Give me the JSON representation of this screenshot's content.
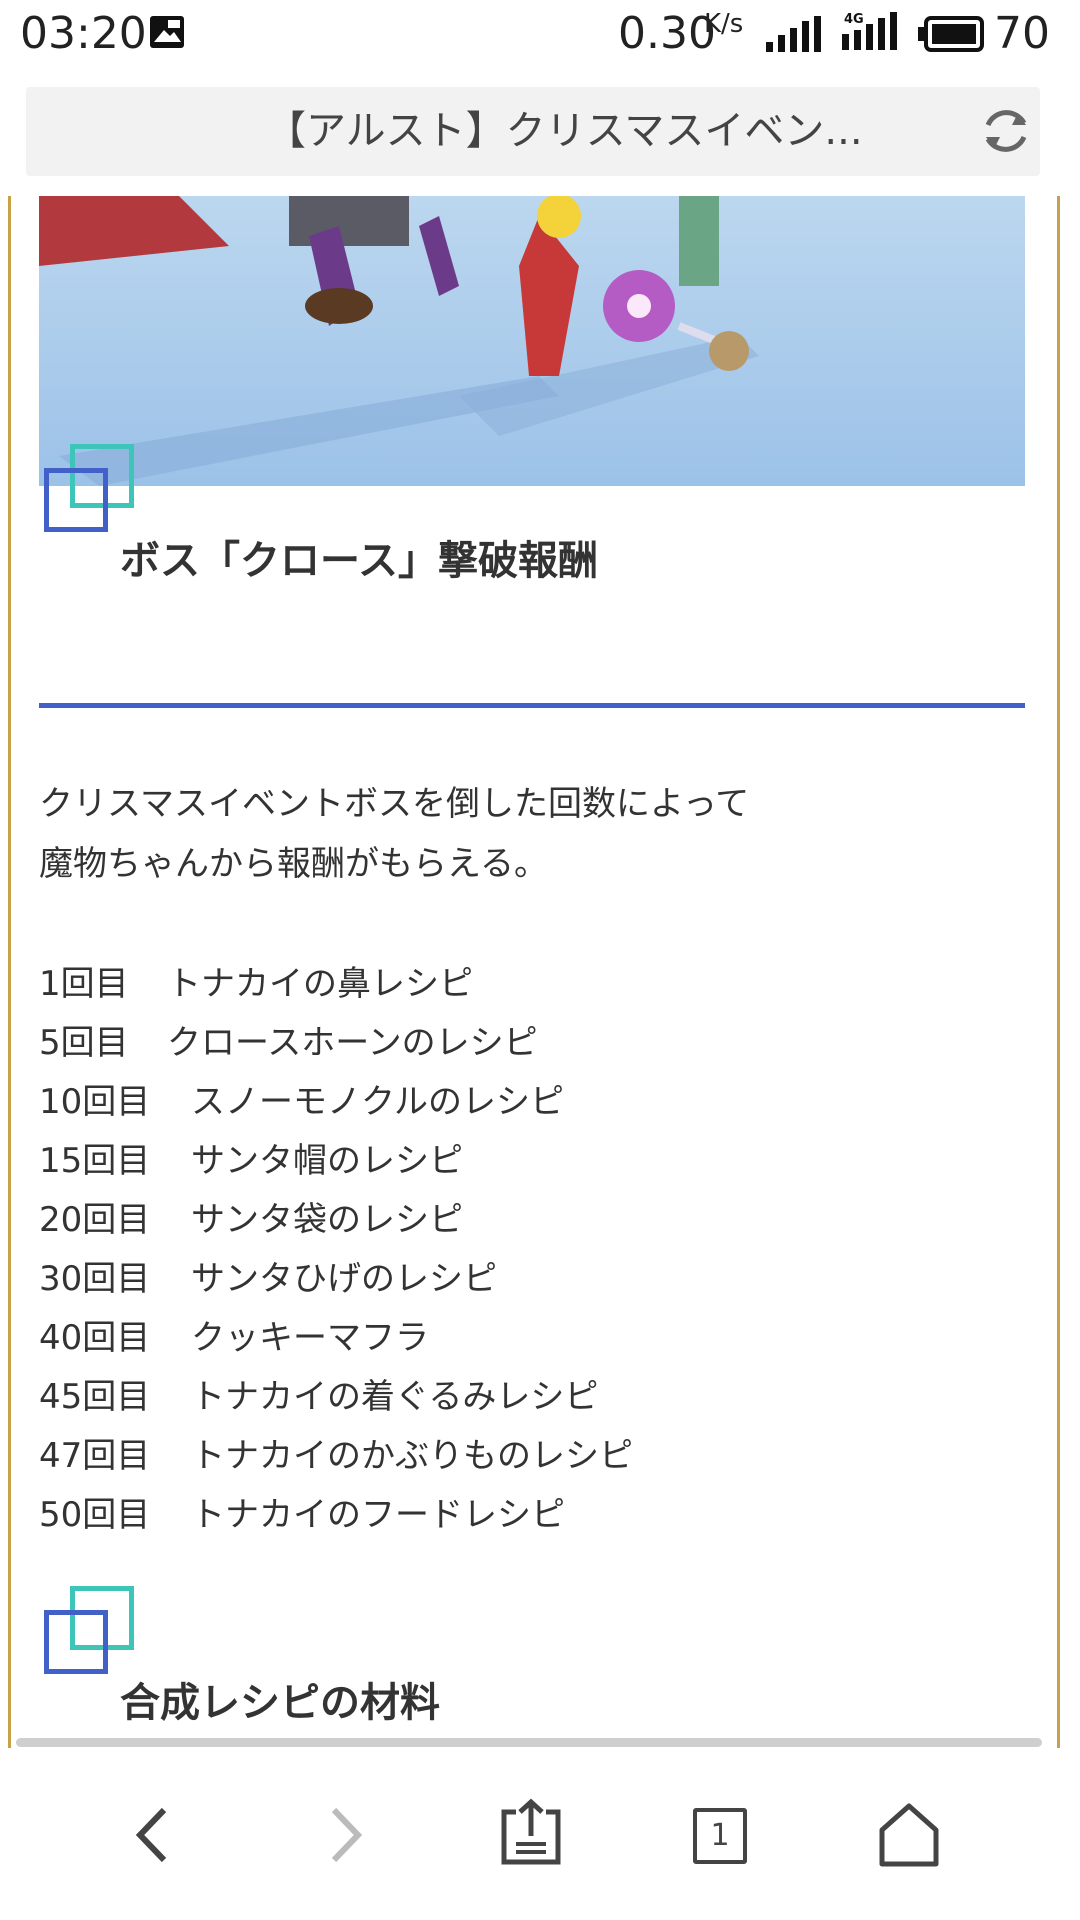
{
  "status_bar": {
    "time": "03:20",
    "speed": "0.30",
    "speed_unit": "K/s",
    "network": "4G",
    "battery": "70"
  },
  "address_bar": {
    "title": "【アルスト】クリスマスイベン..."
  },
  "article": {
    "banner_alt": "game-screenshot-snow-scene",
    "section1": {
      "heading": "ボス「クロース」撃破報酬",
      "intro_line1": "クリスマスイベントボスを倒した回数によって",
      "intro_line2": "魔物ちゃんから報酬がもらえる。",
      "rewards": [
        {
          "count": "1回目",
          "item": "トナカイの鼻レシピ"
        },
        {
          "count": "5回目",
          "item": "クロースホーンのレシピ"
        },
        {
          "count": "10回目",
          "item": "スノーモノクルのレシピ"
        },
        {
          "count": "15回目",
          "item": "サンタ帽のレシピ"
        },
        {
          "count": "20回目",
          "item": "サンタ袋のレシピ"
        },
        {
          "count": "30回目",
          "item": "サンタひげのレシピ"
        },
        {
          "count": "40回目",
          "item": "クッキーマフラ"
        },
        {
          "count": "45回目",
          "item": "トナカイの着ぐるみレシピ"
        },
        {
          "count": "47回目",
          "item": "トナカイのかぶりものレシピ"
        },
        {
          "count": "50回目",
          "item": "トナカイのフードレシピ"
        }
      ]
    },
    "section2": {
      "heading": "合成レシピの材料"
    }
  },
  "bottom_nav": {
    "tab_count": "1"
  },
  "colors": {
    "accent_blue": "#4261c8",
    "accent_teal": "#3ec5b9",
    "border_gold": "#c8a24a"
  }
}
